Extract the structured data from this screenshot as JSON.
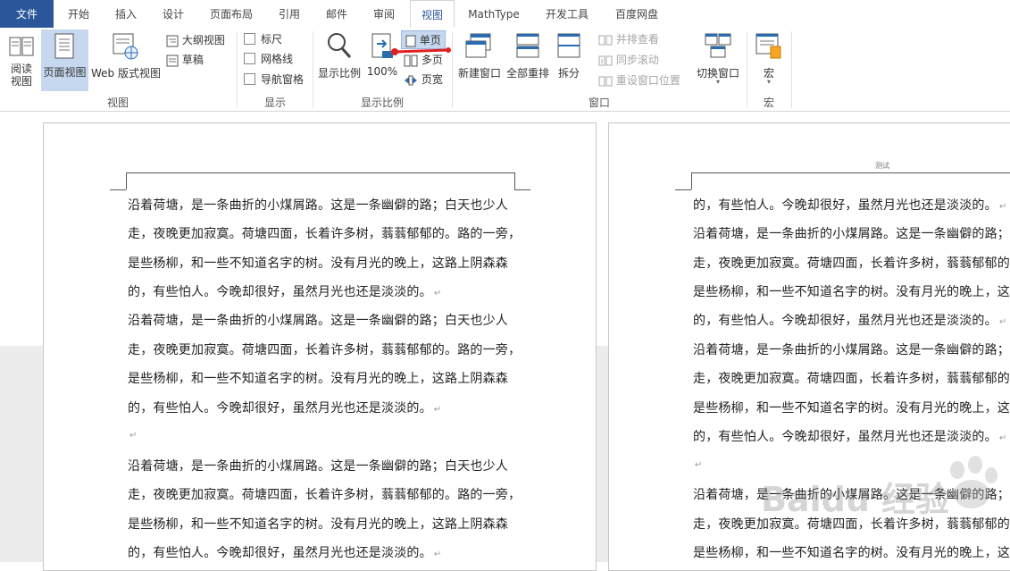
{
  "tabs": {
    "file": "文件",
    "home": "开始",
    "insert": "插入",
    "design": "设计",
    "layout": "页面布局",
    "references": "引用",
    "mailings": "邮件",
    "review": "审阅",
    "view": "视图",
    "mathtype": "MathType",
    "developer": "开发工具",
    "baidu": "百度网盘"
  },
  "ribbon": {
    "views": {
      "read_mode": "阅读\n视图",
      "print_layout": "页面视图",
      "web_layout": "Web 版式视图",
      "outline": "大纲视图",
      "draft": "草稿",
      "group": "视图"
    },
    "show": {
      "ruler": "标尺",
      "gridlines": "网格线",
      "nav_pane": "导航窗格",
      "group": "显示"
    },
    "zoom": {
      "zoom": "显示比例",
      "hundred": "100%",
      "one_page": "单页",
      "multi_page": "多页",
      "page_width": "页宽",
      "group": "显示比例"
    },
    "window": {
      "new_window": "新建窗口",
      "arrange_all": "全部重排",
      "split": "拆分",
      "side_by_side": "并排查看",
      "sync_scroll": "同步滚动",
      "reset_pos": "重设窗口位置",
      "switch": "切换窗口",
      "group": "窗口"
    },
    "macros": {
      "macros": "宏",
      "group": "宏"
    }
  },
  "document": {
    "right_header": "测试",
    "left_page": [
      "沿着荷塘，是一条曲折的小煤屑路。这是一条幽僻的路；白天也少人",
      "走，夜晚更加寂寞。荷塘四面，长着许多树，蓊蓊郁郁的。路的一旁，",
      "是些杨柳，和一些不知道名字的树。没有月光的晚上，这路上阴森森",
      "的，有些怕人。今晚却很好，虽然月光也还是淡淡的。",
      "沿着荷塘，是一条曲折的小煤屑路。这是一条幽僻的路；白天也少人",
      "走，夜晚更加寂寞。荷塘四面，长着许多树，蓊蓊郁郁的。路的一旁，",
      "是些杨柳，和一些不知道名字的树。没有月光的晚上，这路上阴森森",
      "的，有些怕人。今晚却很好，虽然月光也还是淡淡的。",
      "",
      "沿着荷塘，是一条曲折的小煤屑路。这是一条幽僻的路；白天也少人",
      "走，夜晚更加寂寞。荷塘四面，长着许多树，蓊蓊郁郁的。路的一旁，",
      "是些杨柳，和一些不知道名字的树。没有月光的晚上，这路上阴森森",
      "的，有些怕人。今晚却很好，虽然月光也还是淡淡的。"
    ],
    "right_page": [
      "的，有些怕人。今晚却很好，虽然月光也还是淡淡的。",
      "沿着荷塘，是一条曲折的小煤屑路。这是一条幽僻的路；",
      "走，夜晚更加寂寞。荷塘四面，长着许多树，蓊蓊郁郁的。",
      "是些杨柳，和一些不知道名字的树。没有月光的晚上，这",
      "的，有些怕人。今晚却很好，虽然月光也还是淡淡的。",
      "沿着荷塘，是一条曲折的小煤屑路。这是一条幽僻的路；",
      "走，夜晚更加寂寞。荷塘四面，长着许多树，蓊蓊郁郁的。",
      "是些杨柳，和一些不知道名字的树。没有月光的晚上，这",
      "的，有些怕人。今晚却很好，虽然月光也还是淡淡的。",
      "",
      "沿着荷塘，是一条曲折的小煤屑路。这是一条幽僻的路；",
      "走，夜晚更加寂寞。荷塘四面，长着许多树，蓊蓊郁郁的。",
      "是些杨柳，和一些不知道名字的树。没有月光的晚上，这"
    ],
    "watermark": "Baidu 经验"
  },
  "colors": {
    "file_tab": "#2b579a",
    "selected_button": "#c5d8ef",
    "annotation_arrow": "#e02020"
  }
}
